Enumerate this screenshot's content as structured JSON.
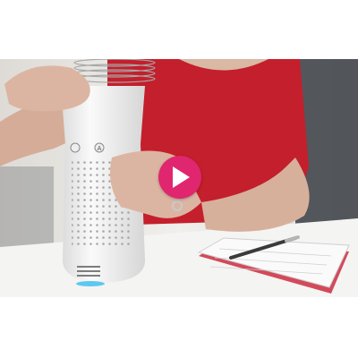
{
  "video": {
    "play_icon": "play-icon",
    "device_button_labels": [
      "",
      "A"
    ],
    "colors": {
      "play_button": "#e0266e",
      "play_glyph": "#ffffff",
      "shirt": "#c41f2c",
      "device_body": "#f3f3f3",
      "device_light": "#5bc8f0",
      "notepad_cover": "#d24a5a"
    }
  }
}
